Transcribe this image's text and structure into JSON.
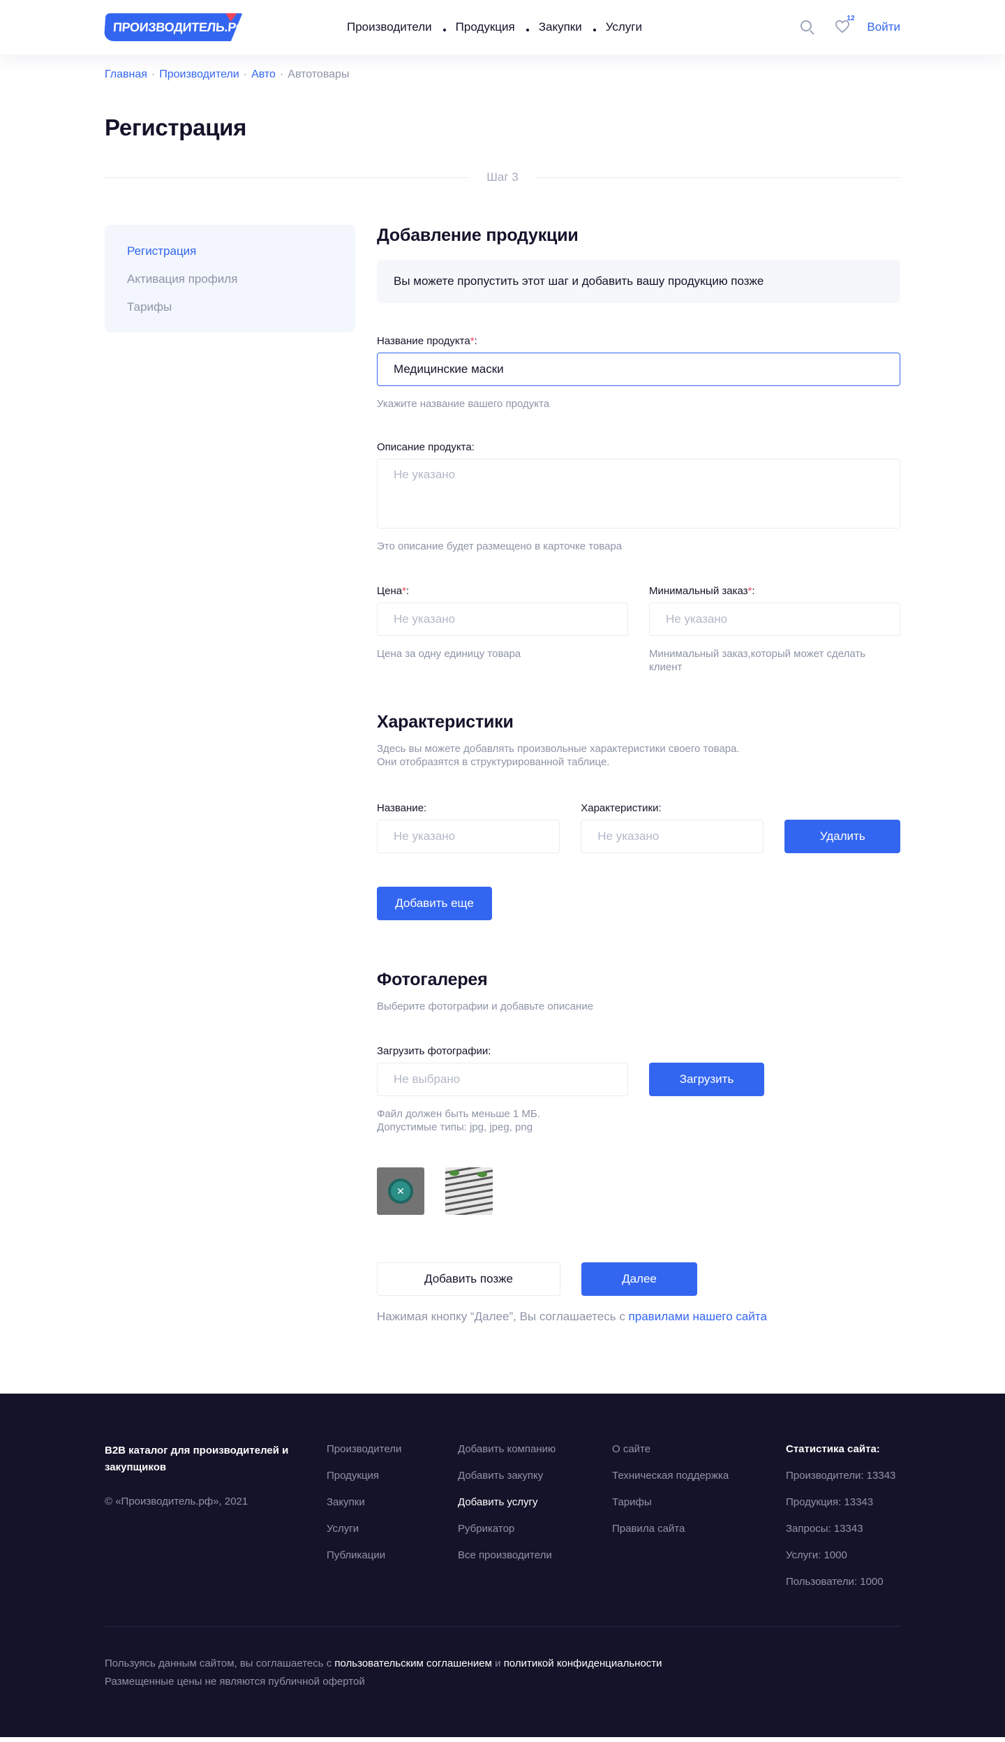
{
  "header": {
    "logo_text": "ПРОИЗВОДИТЕЛЬ.РФ",
    "nav": [
      {
        "label": "Производители"
      },
      {
        "label": "Продукция"
      },
      {
        "label": "Закупки"
      },
      {
        "label": "Услуги"
      }
    ],
    "favorites_count": "12",
    "login_label": "Войти"
  },
  "breadcrumb": {
    "items": [
      "Главная",
      "Производители",
      "Авто"
    ],
    "current": "Автотовары",
    "separator": "·"
  },
  "page": {
    "title": "Регистрация",
    "step_label": "Шаг 3"
  },
  "sidebar": {
    "items": [
      {
        "label": "Регистрация",
        "active": true
      },
      {
        "label": "Активация профиля",
        "active": false
      },
      {
        "label": "Тарифы",
        "active": false
      }
    ]
  },
  "product": {
    "title": "Добавление продукции",
    "info": "Вы можете пропустить этот шаг и  добавить вашу продукцию позже",
    "name_label": "Название продукта",
    "required_mark": "*",
    "colon": ":",
    "name_value": "Медицинские маски",
    "name_hint": "Укажите название вашего продукта",
    "description_label": "Описание продукта:",
    "description_placeholder": "Не указано",
    "description_hint": "Это описание будет размещено в карточке товара",
    "price_label": "Цена",
    "price_placeholder": "Не указано",
    "price_hint": "Цена за одну единицу товара",
    "min_order_label": "Минимальный заказ",
    "min_order_placeholder": "Не указано",
    "min_order_hint": "Минимальный заказ,который может сделать клиент"
  },
  "characteristics": {
    "title": "Характеристики",
    "subtitle_1": "Здесь вы можете добавлять произвольные характеристики  своего товара.",
    "subtitle_2": "Они  отобразятся в структурированной таблице.",
    "name_label": "Название:",
    "name_placeholder": "Не указано",
    "value_label": "Характеристики:",
    "value_placeholder": "Не указано",
    "delete_label": "Удалить",
    "add_more_label": "Добавить еще"
  },
  "gallery": {
    "title": "Фотогалерея",
    "subtitle": "Выберите фотографии  и  добавьте описание",
    "upload_label": "Загрузить фотографии:",
    "file_placeholder": "Не выбрано",
    "upload_button": "Загрузить",
    "hint_1": "Файл должен быть меньше 1 МБ.",
    "hint_2": "Допустимые типы: jpg, jpeg, png",
    "remove_glyph": "✕"
  },
  "actions": {
    "later_label": "Добавить позже",
    "next_label": "Далее",
    "agree_text": "Нажимая кнопку “Далее”, Вы соглашаетесь с ",
    "agree_link": "правилами нашего сайта"
  },
  "footer": {
    "brand": "B2B каталог для производителей и закупщиков",
    "copyright": "© «Производитель.рф», 2021",
    "col1": [
      "Производители",
      "Продукция",
      "Закупки",
      "Услуги",
      "Публикации"
    ],
    "col2": [
      "Добавить компанию",
      "Добавить закупку",
      "Добавить услугу",
      "Рубрикатор",
      "Все производители"
    ],
    "col3": [
      "О сайте",
      "Техническая поддержка",
      "Тарифы",
      "Правила сайта"
    ],
    "stats_title": "Статистика сайта:",
    "stats": [
      "Производители: 13343",
      "Продукция: 13343",
      "Запросы: 13343",
      "Услуги: 1000",
      "Пользователи: 1000"
    ],
    "legal_prefix": "Пользуясь данным сайтом, вы соглашаетесь с ",
    "legal_link1": "пользовательским соглашением",
    "legal_and": " и ",
    "legal_link2": "политикой конфиденциальности",
    "offer_text": "Размещенные цены не являются публичной офертой"
  },
  "colors": {
    "accent": "#3366f0",
    "required": "#f0455a",
    "footer_bg": "#151329",
    "muted": "#8e94a8"
  }
}
